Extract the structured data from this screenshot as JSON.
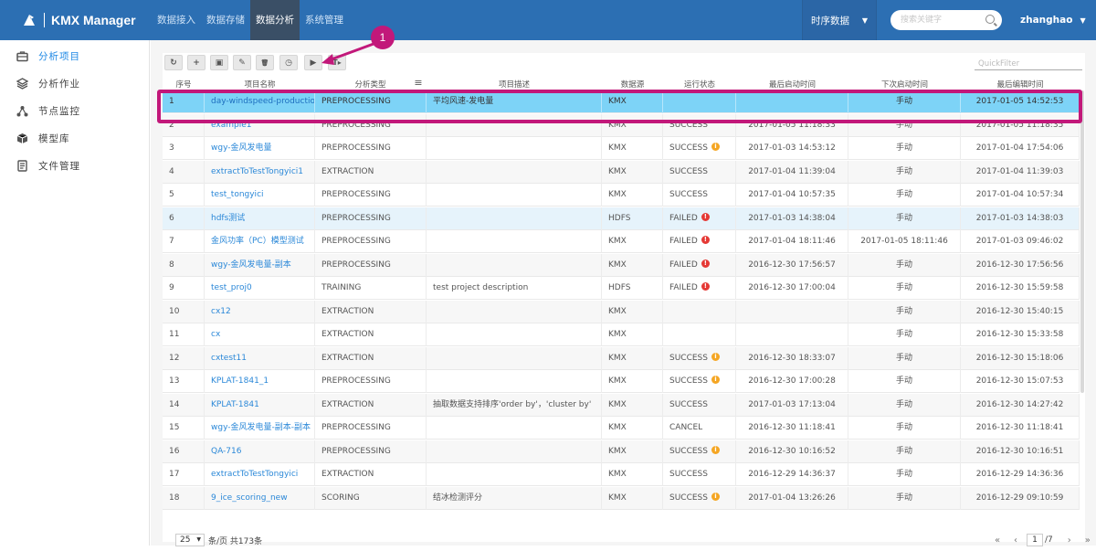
{
  "app": {
    "title": "KMX Manager"
  },
  "nav": [
    {
      "label": "数据接入"
    },
    {
      "label": "数据存储"
    },
    {
      "label": "数据分析"
    },
    {
      "label": "系统管理"
    }
  ],
  "header": {
    "select_label": "时序数据",
    "search_placeholder": "搜索关键字",
    "username": "zhanghao"
  },
  "sidebar": [
    {
      "label": "分析项目",
      "icon": "briefcase-icon"
    },
    {
      "label": "分析作业",
      "icon": "layers-icon"
    },
    {
      "label": "节点监控",
      "icon": "nodes-icon"
    },
    {
      "label": "模型库",
      "icon": "cube-icon"
    },
    {
      "label": "文件管理",
      "icon": "file-icon"
    }
  ],
  "toolbar": {
    "refresh": "↻",
    "add": "+",
    "save": "▣",
    "edit": "✎",
    "delete": "🗑",
    "schedule": "◷",
    "run": "▶",
    "text": "T▸",
    "quickfilter_placeholder": "QuickFilter"
  },
  "columns": [
    "序号",
    "项目名称",
    "分析类型",
    "项目描述",
    "数据源",
    "运行状态",
    "最后启动时间",
    "下次启动时间",
    "最后编辑时间"
  ],
  "rows": [
    {
      "no": "1",
      "name": "day-windspeed-production",
      "type": "PREPROCESSING",
      "desc": "平均风速-发电量",
      "src": "KMX",
      "status": "",
      "icon": "",
      "last_start": "",
      "next_start": "手动",
      "last_edit": "2017-01-05 14:52:53"
    },
    {
      "no": "2",
      "name": "example1",
      "type": "PREPROCESSING",
      "desc": "",
      "src": "KMX",
      "status": "SUCCESS",
      "icon": "",
      "last_start": "2017-01-05 11:18:33",
      "next_start": "手动",
      "last_edit": "2017-01-05 11:18:35"
    },
    {
      "no": "3",
      "name": "wgy-金风发电量",
      "type": "PREPROCESSING",
      "desc": "",
      "src": "KMX",
      "status": "SUCCESS",
      "icon": "warn",
      "last_start": "2017-01-03 14:53:12",
      "next_start": "手动",
      "last_edit": "2017-01-04 17:54:06"
    },
    {
      "no": "4",
      "name": "extractToTestTongyici1",
      "type": "EXTRACTION",
      "desc": "",
      "src": "KMX",
      "status": "SUCCESS",
      "icon": "",
      "last_start": "2017-01-04 11:39:04",
      "next_start": "手动",
      "last_edit": "2017-01-04 11:39:03"
    },
    {
      "no": "5",
      "name": "test_tongyici",
      "type": "PREPROCESSING",
      "desc": "",
      "src": "KMX",
      "status": "SUCCESS",
      "icon": "",
      "last_start": "2017-01-04 10:57:35",
      "next_start": "手动",
      "last_edit": "2017-01-04 10:57:34"
    },
    {
      "no": "6",
      "name": "hdfs测试",
      "type": "PREPROCESSING",
      "desc": "",
      "src": "HDFS",
      "status": "FAILED",
      "icon": "err",
      "last_start": "2017-01-03 14:38:04",
      "next_start": "手动",
      "last_edit": "2017-01-03 14:38:03"
    },
    {
      "no": "7",
      "name": "金风功率（PC）模型测试",
      "type": "PREPROCESSING",
      "desc": "",
      "src": "KMX",
      "status": "FAILED",
      "icon": "err",
      "last_start": "2017-01-04 18:11:46",
      "next_start": "2017-01-05 18:11:46",
      "last_edit": "2017-01-03 09:46:02"
    },
    {
      "no": "8",
      "name": "wgy-金风发电量-副本",
      "type": "PREPROCESSING",
      "desc": "",
      "src": "KMX",
      "status": "FAILED",
      "icon": "err",
      "last_start": "2016-12-30 17:56:57",
      "next_start": "手动",
      "last_edit": "2016-12-30 17:56:56"
    },
    {
      "no": "9",
      "name": "test_proj0",
      "type": "TRAINING",
      "desc": "test project description",
      "src": "HDFS",
      "status": "FAILED",
      "icon": "err",
      "last_start": "2016-12-30 17:00:04",
      "next_start": "手动",
      "last_edit": "2016-12-30 15:59:58"
    },
    {
      "no": "10",
      "name": "cx12",
      "type": "EXTRACTION",
      "desc": "",
      "src": "KMX",
      "status": "",
      "icon": "",
      "last_start": "",
      "next_start": "手动",
      "last_edit": "2016-12-30 15:40:15"
    },
    {
      "no": "11",
      "name": "cx",
      "type": "EXTRACTION",
      "desc": "",
      "src": "KMX",
      "status": "",
      "icon": "",
      "last_start": "",
      "next_start": "手动",
      "last_edit": "2016-12-30 15:33:58"
    },
    {
      "no": "12",
      "name": "cxtest11",
      "type": "EXTRACTION",
      "desc": "",
      "src": "KMX",
      "status": "SUCCESS",
      "icon": "warn",
      "last_start": "2016-12-30 18:33:07",
      "next_start": "手动",
      "last_edit": "2016-12-30 15:18:06"
    },
    {
      "no": "13",
      "name": "KPLAT-1841_1",
      "type": "PREPROCESSING",
      "desc": "",
      "src": "KMX",
      "status": "SUCCESS",
      "icon": "warn",
      "last_start": "2016-12-30 17:00:28",
      "next_start": "手动",
      "last_edit": "2016-12-30 15:07:53"
    },
    {
      "no": "14",
      "name": "KPLAT-1841",
      "type": "EXTRACTION",
      "desc": "抽取数据支持排序'order by'，'cluster by'",
      "src": "KMX",
      "status": "SUCCESS",
      "icon": "",
      "last_start": "2017-01-03 17:13:04",
      "next_start": "手动",
      "last_edit": "2016-12-30 14:27:42"
    },
    {
      "no": "15",
      "name": "wgy-金风发电量-副本-副本",
      "type": "PREPROCESSING",
      "desc": "",
      "src": "KMX",
      "status": "CANCEL",
      "icon": "",
      "last_start": "2016-12-30 11:18:41",
      "next_start": "手动",
      "last_edit": "2016-12-30 11:18:41"
    },
    {
      "no": "16",
      "name": "QA-716",
      "type": "PREPROCESSING",
      "desc": "",
      "src": "KMX",
      "status": "SUCCESS",
      "icon": "warn",
      "last_start": "2016-12-30 10:16:52",
      "next_start": "手动",
      "last_edit": "2016-12-30 10:16:51"
    },
    {
      "no": "17",
      "name": "extractToTestTongyici",
      "type": "EXTRACTION",
      "desc": "",
      "src": "KMX",
      "status": "SUCCESS",
      "icon": "",
      "last_start": "2016-12-29 14:36:37",
      "next_start": "手动",
      "last_edit": "2016-12-29 14:36:36"
    },
    {
      "no": "18",
      "name": "9_ice_scoring_new",
      "type": "SCORING",
      "desc": "结冰检测评分",
      "src": "KMX",
      "status": "SUCCESS",
      "icon": "warn",
      "last_start": "2017-01-04 13:26:26",
      "next_start": "手动",
      "last_edit": "2016-12-29 09:10:59"
    }
  ],
  "footer": {
    "page_size": "25",
    "page_info": "条/页 共173条",
    "current_page": "1",
    "total_pages": "/7"
  },
  "annotation": {
    "callout_number": "1",
    "color": "#c2187a"
  }
}
